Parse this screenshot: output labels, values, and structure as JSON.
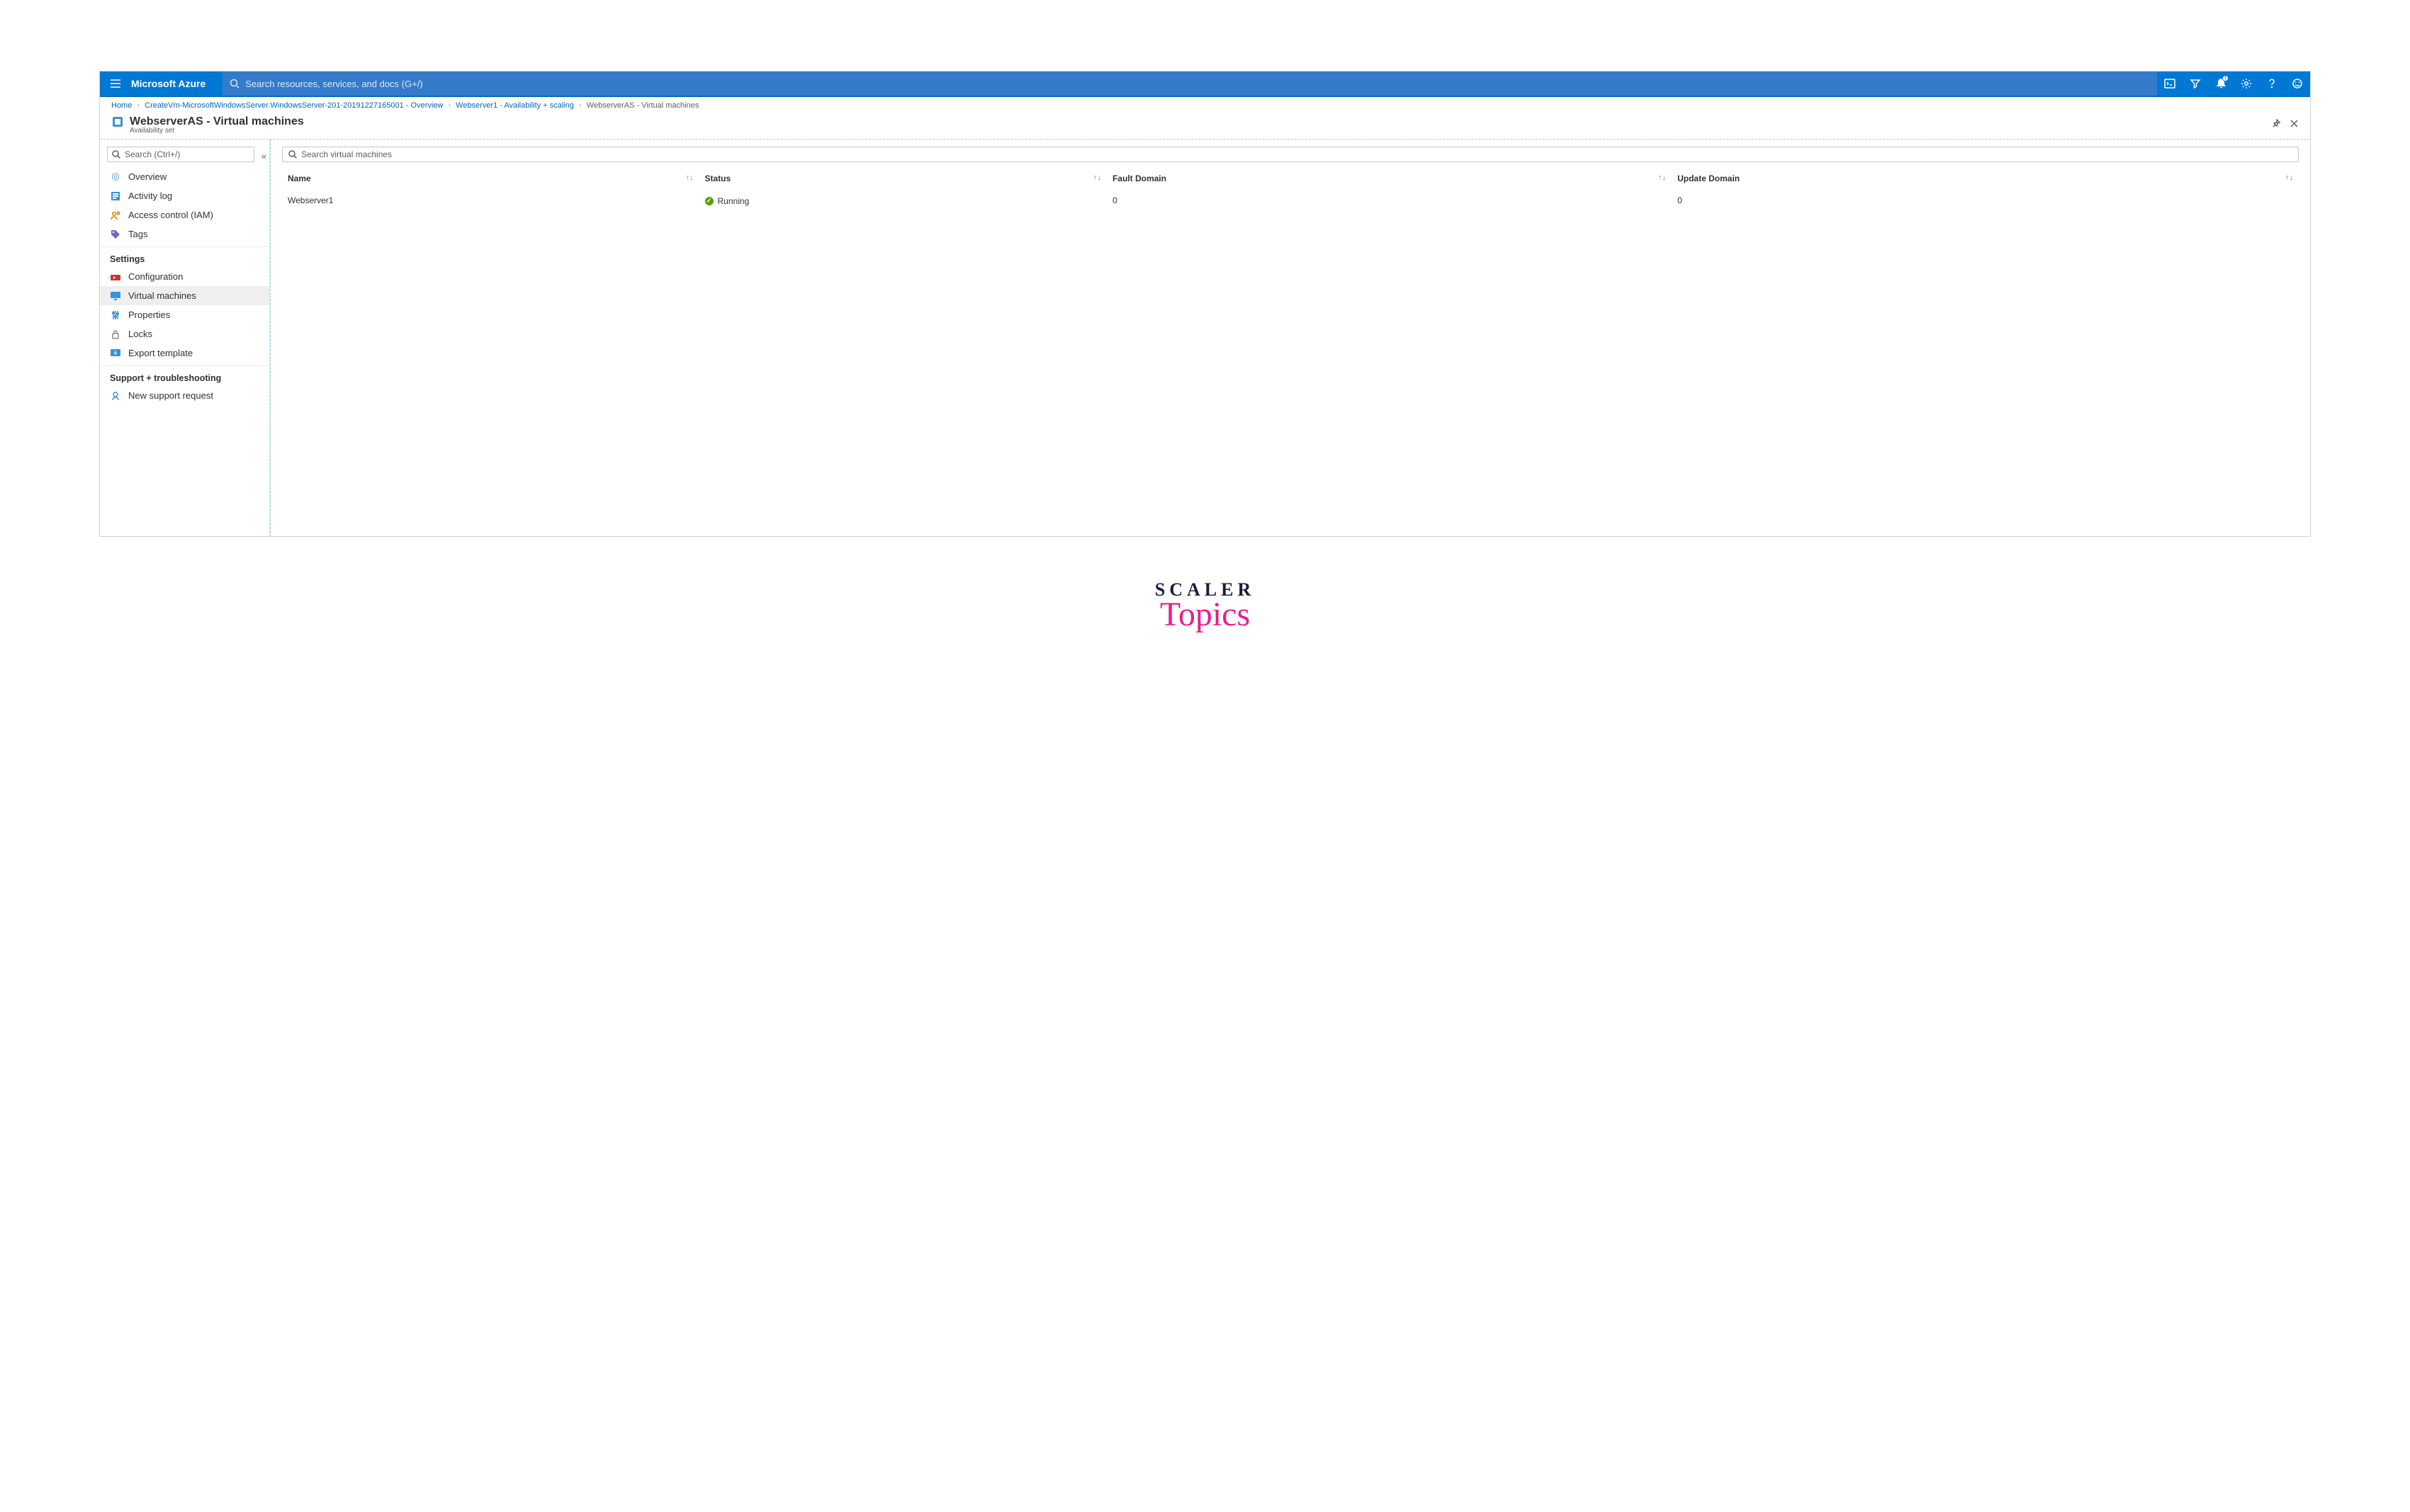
{
  "topbar": {
    "brand": "Microsoft Azure",
    "search_placeholder": "Search resources, services, and docs (G+/)",
    "notification_count": "1"
  },
  "breadcrumb": {
    "home": "Home",
    "items": [
      "CreateVm-MicrosoftWindowsServer.WindowsServer-201-20191227165001 - Overview",
      "Webserver1 - Availability + scaling"
    ],
    "current": "WebserverAS - Virtual machines"
  },
  "page": {
    "title": "WebserverAS - Virtual machines",
    "subtitle": "Availability set"
  },
  "sidebar": {
    "search_placeholder": "Search (Ctrl+/)",
    "items": {
      "overview": "Overview",
      "activity": "Activity log",
      "iam": "Access control (IAM)",
      "tags": "Tags"
    },
    "settings_label": "Settings",
    "settings_items": {
      "configuration": "Configuration",
      "vm": "Virtual machines",
      "properties": "Properties",
      "locks": "Locks",
      "export": "Export template"
    },
    "support_label": "Support + troubleshooting",
    "support_items": {
      "newreq": "New support request"
    }
  },
  "main": {
    "search_placeholder": "Search virtual machines",
    "columns": {
      "name": "Name",
      "status": "Status",
      "fault": "Fault Domain",
      "update": "Update Domain"
    },
    "rows": [
      {
        "name": "Webserver1",
        "status": "Running",
        "fault": "0",
        "update": "0"
      }
    ]
  },
  "watermark": {
    "line1": "SCALER",
    "line2": "Topics"
  }
}
